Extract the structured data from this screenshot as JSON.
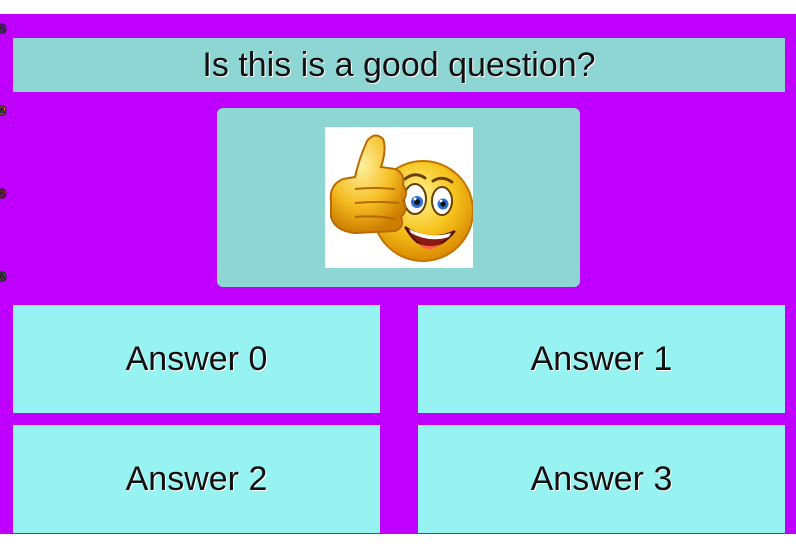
{
  "question": {
    "text": "Is this is a good question?"
  },
  "image": {
    "icon": "thumbs-up-smiley-icon"
  },
  "side_markers": [
    "e",
    "e",
    "e",
    "e"
  ],
  "answers": [
    {
      "label": "Answer 0"
    },
    {
      "label": "Answer 1"
    },
    {
      "label": "Answer 2"
    },
    {
      "label": "Answer 3"
    }
  ],
  "colors": {
    "background": "#bf00ff",
    "question_panel": "#8ed6d4",
    "answer_tile": "#96f3f2"
  }
}
